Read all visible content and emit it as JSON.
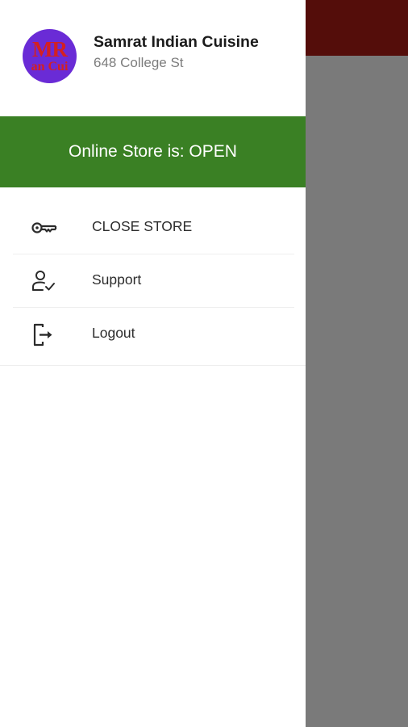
{
  "store": {
    "name": "Samrat Indian Cuisine",
    "address": "648 College St",
    "logo_text_top": "MR",
    "logo_text_bottom": "an Cui"
  },
  "status": {
    "text": "Online Store is: OPEN",
    "color": "#3a8024"
  },
  "menu": {
    "items": [
      {
        "label": "CLOSE STORE",
        "icon": "key-icon"
      },
      {
        "label": "Support",
        "icon": "user-check-icon"
      },
      {
        "label": "Logout",
        "icon": "logout-icon"
      }
    ]
  },
  "colors": {
    "app_bar": "#540d0a",
    "scrim": "#7a7a7a",
    "logo_background": "#6a2bd6",
    "logo_text": "#d42020"
  }
}
